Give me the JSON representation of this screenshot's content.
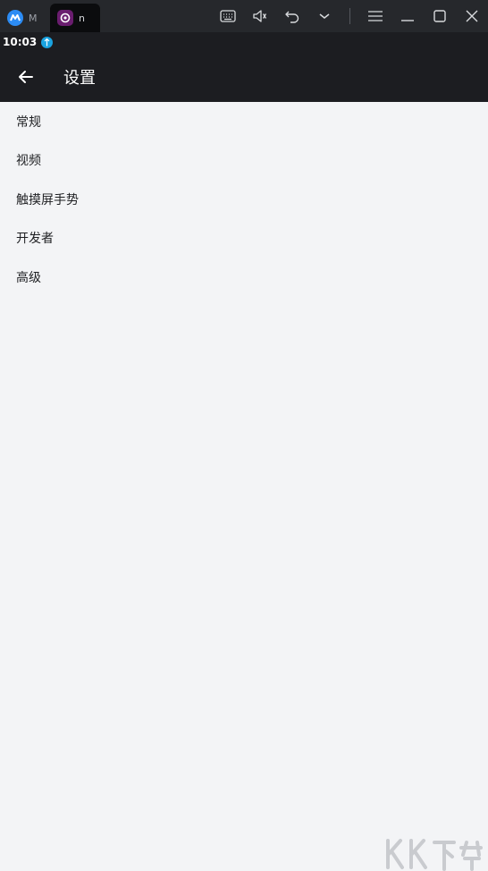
{
  "window": {
    "tabs": [
      {
        "label": "M",
        "icon": "app-logo-icon"
      },
      {
        "label": "n",
        "icon": "app-launcher-icon"
      }
    ],
    "toolbar": [
      "keyboard-icon",
      "volume-icon",
      "undo-icon",
      "chevron-down-icon",
      "menu-icon",
      "minimize-icon",
      "maximize-icon",
      "close-icon"
    ]
  },
  "status_bar": {
    "time": "10:03"
  },
  "app_bar": {
    "title": "设置"
  },
  "settings": {
    "items": [
      {
        "label": "常规"
      },
      {
        "label": "视频"
      },
      {
        "label": "触摸屏手势"
      },
      {
        "label": "开发者"
      },
      {
        "label": "高级"
      }
    ]
  },
  "watermark": {
    "text": "KK下载"
  },
  "colors": {
    "window_bar": "#26282c",
    "app_bar": "#1c1d21",
    "background": "#f3f4f6",
    "accent": "#2c8cf4"
  }
}
